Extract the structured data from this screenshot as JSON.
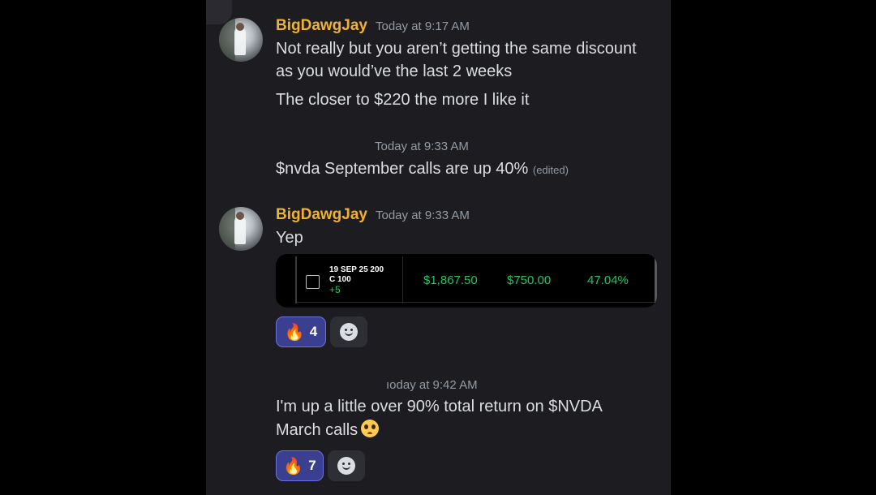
{
  "messages": [
    {
      "username": "BigDawgJay",
      "timestamp": "Today at 9:17 AM",
      "lines": [
        "Not really but you aren’t getting the same discount",
        "as you would’ve the last 2 weeks"
      ],
      "followup": "The closer to $220 the more I like it"
    },
    {
      "timestamp": "Today at 9:33 AM",
      "text": "$nvda September calls are up 40%",
      "edited": "(edited)"
    },
    {
      "username": "BigDawgJay",
      "timestamp": "Today at 9:33 AM",
      "text": "Yep",
      "embed": {
        "contract_line1": "19 SEP 25 200",
        "contract_line2": "C 100",
        "quantity": "+5",
        "value": "$1,867.50",
        "gain": "$750.00",
        "percent": "47.04%"
      },
      "reactions": [
        {
          "icon": "fire-emoji",
          "count": "4"
        }
      ]
    },
    {
      "timestamp": "ıoday at 9:42 AM",
      "lines": [
        "I'm up a little over 90% total return on $NVDA",
        "March calls"
      ],
      "trailing_emoji": "pleading-face-emoji",
      "reactions": [
        {
          "icon": "fire-emoji",
          "count": "7"
        }
      ]
    }
  ],
  "colors": {
    "username": "#f0b232",
    "timestamp": "#949ba4",
    "text": "#dbdee1",
    "gain_green": "#22c55e",
    "reaction_active_bg": "#3b3f8f",
    "background": "#1c1c21"
  }
}
